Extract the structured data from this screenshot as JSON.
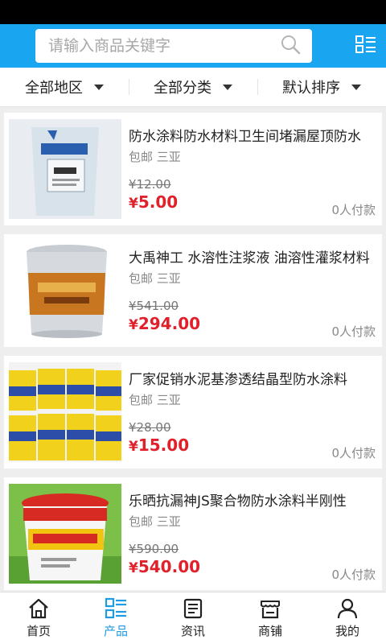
{
  "search": {
    "placeholder": "请输入商品关键字"
  },
  "filters": [
    {
      "label": "全部地区"
    },
    {
      "label": "全部分类"
    },
    {
      "label": "默认排序"
    }
  ],
  "products": [
    {
      "title": "防水涂料防水材料卫生间堵漏屋顶防水",
      "tags": "包邮 三亚",
      "old_price": "¥12.00",
      "price": "5.00",
      "sold": "0人付款",
      "image_icon": "bag-product-image"
    },
    {
      "title": "大禹神工 水溶性注浆液 油溶性灌浆材料",
      "tags": "包邮 三亚",
      "old_price": "¥541.00",
      "price": "294.00",
      "sold": "0人付款",
      "image_icon": "bucket-product-image"
    },
    {
      "title": "厂家促销水泥基渗透结晶型防水涂料",
      "tags": "包邮 三亚",
      "old_price": "¥28.00",
      "price": "15.00",
      "sold": "0人付款",
      "image_icon": "cans-product-image"
    },
    {
      "title": "乐晒抗漏神JS聚合物防水涂料半刚性",
      "tags": "包邮 三亚",
      "old_price": "¥590.00",
      "price": "540.00",
      "sold": "0人付款",
      "image_icon": "pail-product-image"
    }
  ],
  "currency_symbol": "¥",
  "tabs": [
    {
      "label": "首页",
      "icon": "home-icon"
    },
    {
      "label": "产品",
      "icon": "list-icon"
    },
    {
      "label": "资讯",
      "icon": "news-icon"
    },
    {
      "label": "商铺",
      "icon": "store-icon"
    },
    {
      "label": "我的",
      "icon": "user-icon"
    }
  ],
  "colors": {
    "accent": "#19a5f0",
    "price": "#e0202a",
    "active_tab": "#1f9be3"
  }
}
